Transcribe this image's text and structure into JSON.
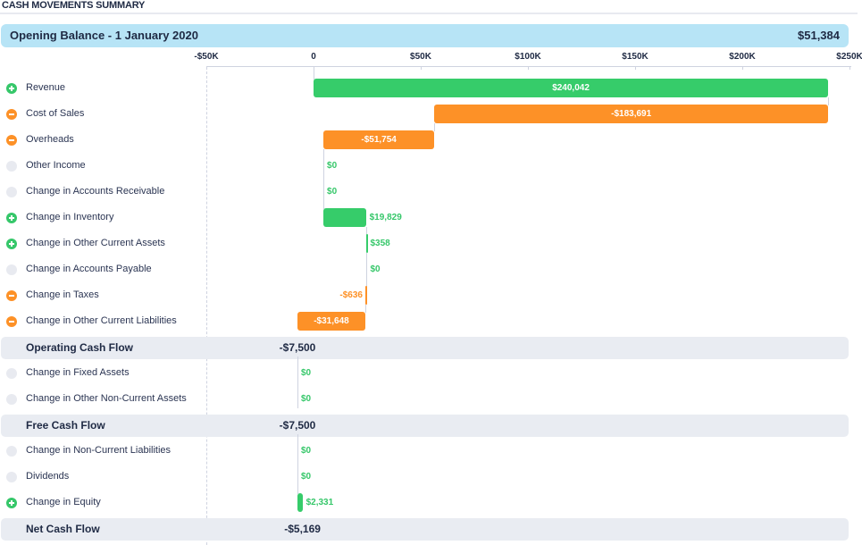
{
  "header": {
    "title": "CASH MOVEMENTS SUMMARY"
  },
  "opening_balance": {
    "label": "Opening Balance - 1 January 2020",
    "value": "$51,384"
  },
  "colors": {
    "positive": "#36cc6a",
    "negative": "#fd9127",
    "neutral": "#e8eaf0",
    "opening_band": "#b7e4f6",
    "total_band": "#e9ecf2",
    "text": "#1f2a44"
  },
  "chart_data": {
    "type": "waterfall",
    "title": "CASH MOVEMENTS SUMMARY",
    "xlabel": "",
    "ylabel": "",
    "xlim": [
      -50000,
      250000
    ],
    "x_ticks": [
      -50000,
      0,
      50000,
      100000,
      150000,
      200000,
      250000
    ],
    "x_tick_labels": [
      "-$50K",
      "0",
      "$50K",
      "$100K",
      "$150K",
      "$200K",
      "$250K"
    ],
    "grid": false,
    "legend": "none",
    "rows": [
      {
        "kind": "item",
        "label": "Revenue",
        "value": 240042,
        "display": "$240,042",
        "sign": "pos"
      },
      {
        "kind": "item",
        "label": "Cost of Sales",
        "value": -183691,
        "display": "-$183,691",
        "sign": "neg"
      },
      {
        "kind": "item",
        "label": "Overheads",
        "value": -51754,
        "display": "-$51,754",
        "sign": "neg"
      },
      {
        "kind": "item",
        "label": "Other Income",
        "value": 0,
        "display": "$0",
        "sign": "zero"
      },
      {
        "kind": "item",
        "label": "Change in Accounts Receivable",
        "value": 0,
        "display": "$0",
        "sign": "zero"
      },
      {
        "kind": "item",
        "label": "Change in Inventory",
        "value": 19829,
        "display": "$19,829",
        "sign": "pos"
      },
      {
        "kind": "item",
        "label": "Change in Other Current Assets",
        "value": 358,
        "display": "$358",
        "sign": "pos"
      },
      {
        "kind": "item",
        "label": "Change in Accounts Payable",
        "value": 0,
        "display": "$0",
        "sign": "zero"
      },
      {
        "kind": "item",
        "label": "Change in Taxes",
        "value": -636,
        "display": "-$636",
        "sign": "neg"
      },
      {
        "kind": "item",
        "label": "Change in Other Current Liabilities",
        "value": -31648,
        "display": "-$31,648",
        "sign": "neg"
      },
      {
        "kind": "total",
        "label": "Operating Cash Flow",
        "value": -7500,
        "display": "-$7,500"
      },
      {
        "kind": "item",
        "label": "Change in Fixed Assets",
        "value": 0,
        "display": "$0",
        "sign": "zero"
      },
      {
        "kind": "item",
        "label": "Change in Other Non-Current Assets",
        "value": 0,
        "display": "$0",
        "sign": "zero"
      },
      {
        "kind": "total",
        "label": "Free Cash Flow",
        "value": -7500,
        "display": "-$7,500"
      },
      {
        "kind": "item",
        "label": "Change in Non-Current Liabilities",
        "value": 0,
        "display": "$0",
        "sign": "zero"
      },
      {
        "kind": "item",
        "label": "Dividends",
        "value": 0,
        "display": "$0",
        "sign": "zero"
      },
      {
        "kind": "item",
        "label": "Change in Equity",
        "value": 2331,
        "display": "$2,331",
        "sign": "pos"
      },
      {
        "kind": "total",
        "label": "Net Cash Flow",
        "value": -5169,
        "display": "-$5,169"
      }
    ]
  }
}
